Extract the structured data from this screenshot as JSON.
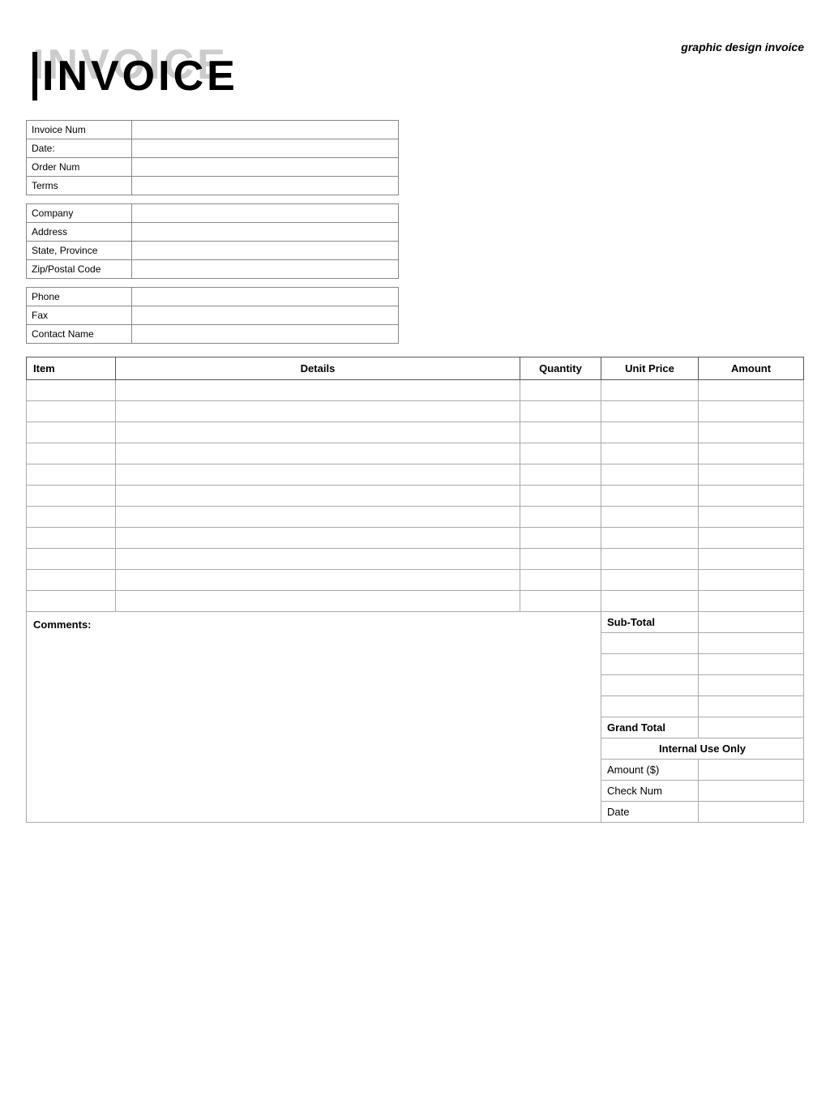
{
  "page": {
    "top_right": "graphic design invoice",
    "invoice_shadow": "INVOICE",
    "invoice_title": "INVOICE"
  },
  "invoice_info": {
    "rows": [
      {
        "label": "Invoice Num",
        "value": ""
      },
      {
        "label": "Date:",
        "value": ""
      },
      {
        "label": "Order Num",
        "value": ""
      },
      {
        "label": "Terms",
        "value": ""
      }
    ]
  },
  "company_info": {
    "rows": [
      {
        "label": "Company",
        "value": ""
      },
      {
        "label": "Address",
        "value": ""
      },
      {
        "label": "State, Province",
        "value": ""
      },
      {
        "label": "Zip/Postal Code",
        "value": ""
      }
    ]
  },
  "contact_info": {
    "rows": [
      {
        "label": "Phone",
        "value": ""
      },
      {
        "label": "Fax",
        "value": ""
      },
      {
        "label": "Contact Name",
        "value": ""
      }
    ]
  },
  "items_table": {
    "headers": {
      "item": "Item",
      "details": "Details",
      "quantity": "Quantity",
      "unit_price": "Unit Price",
      "amount": "Amount"
    },
    "rows": [
      {
        "item": "",
        "details": "",
        "quantity": "",
        "unit_price": "",
        "amount": ""
      },
      {
        "item": "",
        "details": "",
        "quantity": "",
        "unit_price": "",
        "amount": ""
      },
      {
        "item": "",
        "details": "",
        "quantity": "",
        "unit_price": "",
        "amount": ""
      },
      {
        "item": "",
        "details": "",
        "quantity": "",
        "unit_price": "",
        "amount": ""
      },
      {
        "item": "",
        "details": "",
        "quantity": "",
        "unit_price": "",
        "amount": ""
      },
      {
        "item": "",
        "details": "",
        "quantity": "",
        "unit_price": "",
        "amount": ""
      },
      {
        "item": "",
        "details": "",
        "quantity": "",
        "unit_price": "",
        "amount": ""
      },
      {
        "item": "",
        "details": "",
        "quantity": "",
        "unit_price": "",
        "amount": ""
      },
      {
        "item": "",
        "details": "",
        "quantity": "",
        "unit_price": "",
        "amount": ""
      },
      {
        "item": "",
        "details": "",
        "quantity": "",
        "unit_price": "",
        "amount": ""
      },
      {
        "item": "",
        "details": "",
        "quantity": "",
        "unit_price": "",
        "amount": ""
      }
    ]
  },
  "totals": {
    "subtotal_label": "Sub-Total",
    "extra_rows": [
      "",
      "",
      "",
      ""
    ],
    "grand_total_label": "Grand Total",
    "internal_use_label": "Internal Use Only",
    "internal_rows": [
      {
        "label": "Amount ($)",
        "value": ""
      },
      {
        "label": "Check Num",
        "value": ""
      },
      {
        "label": "Date",
        "value": ""
      }
    ]
  },
  "comments": {
    "label": "Comments:"
  }
}
